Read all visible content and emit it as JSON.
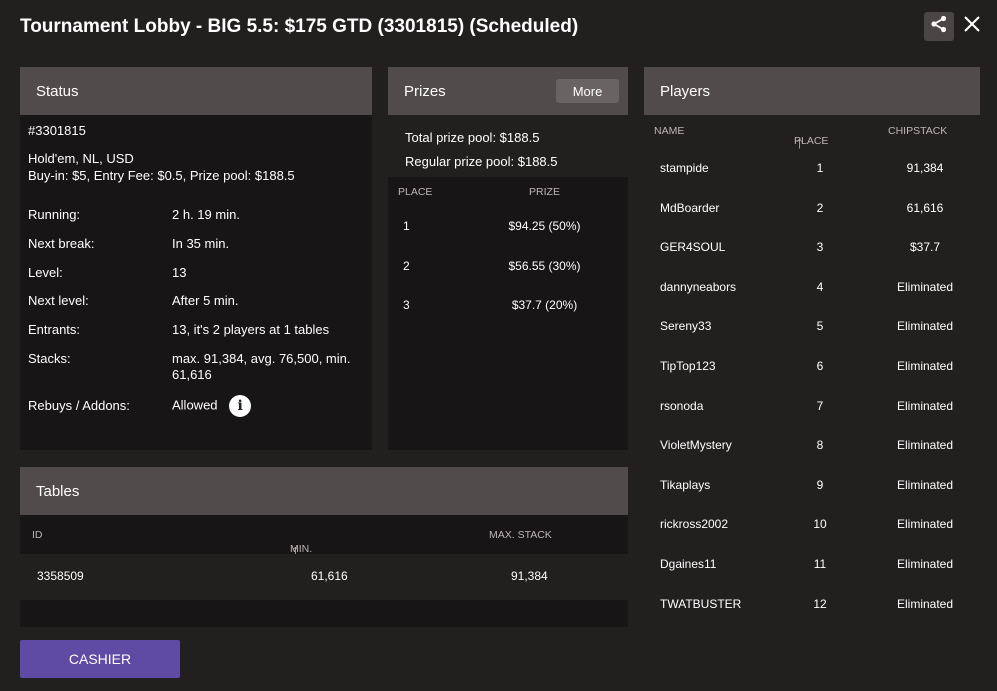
{
  "window": {
    "title": "Tournament Lobby - BIG 5.5: $175 GTD (3301815) (Scheduled)"
  },
  "status": {
    "header": "Status",
    "id": "#3301815",
    "game": "Hold'em, NL, USD",
    "buyin": "Buy-in: $5, Entry Fee: $0.5, Prize pool: $188.5",
    "rows": [
      {
        "label": "Running:",
        "value": "2 h. 19 min."
      },
      {
        "label": "Next break:",
        "value": "In 35 min."
      },
      {
        "label": "Level:",
        "value": "13"
      },
      {
        "label": "Next level:",
        "value": "After 5 min."
      },
      {
        "label": "Entrants:",
        "value": "13, it's 2 players at 1 tables"
      },
      {
        "label": "Stacks:",
        "value": "max. 91,384, avg. 76,500, min. 61,616"
      },
      {
        "label": "Rebuys / Addons:",
        "value": "Allowed"
      }
    ],
    "info_icon": "i"
  },
  "prizes": {
    "header": "Prizes",
    "more_label": "More",
    "total": "Total prize pool: $188.5",
    "regular": "Regular prize pool: $188.5",
    "col_place": "PLACE",
    "col_prize": "PRIZE",
    "rows": [
      {
        "place": "1",
        "prize": "$94.25 (50%)"
      },
      {
        "place": "2",
        "prize": "$56.55 (30%)"
      },
      {
        "place": "3",
        "prize": "$37.7 (20%)"
      }
    ]
  },
  "players": {
    "header": "Players",
    "col_name": "NAME",
    "col_place": "PLACE",
    "col_chips": "CHIPSTACK",
    "rows": [
      {
        "name": "stampide",
        "place": "1",
        "chips": "91,384"
      },
      {
        "name": "MdBoarder",
        "place": "2",
        "chips": "61,616"
      },
      {
        "name": "GER4SOUL",
        "place": "3",
        "chips": "$37.7"
      },
      {
        "name": "dannyneabors",
        "place": "4",
        "chips": "Eliminated"
      },
      {
        "name": "Sereny33",
        "place": "5",
        "chips": "Eliminated"
      },
      {
        "name": "TipTop123",
        "place": "6",
        "chips": "Eliminated"
      },
      {
        "name": "rsonoda",
        "place": "7",
        "chips": "Eliminated"
      },
      {
        "name": "VioletMystery",
        "place": "8",
        "chips": "Eliminated"
      },
      {
        "name": "Tikaplays",
        "place": "9",
        "chips": "Eliminated"
      },
      {
        "name": "rickross2002",
        "place": "10",
        "chips": "Eliminated"
      },
      {
        "name": "Dgaines11",
        "place": "11",
        "chips": "Eliminated"
      },
      {
        "name": "TWATBUSTER",
        "place": "12",
        "chips": "Eliminated"
      }
    ]
  },
  "tables": {
    "header": "Tables",
    "col_id": "ID",
    "col_min": "MIN. STACK",
    "col_max": "MAX. STACK",
    "rows": [
      {
        "id": "3358509",
        "min": "61,616",
        "max": "91,384"
      }
    ]
  },
  "cashier_label": "CASHIER",
  "sort_arrow": "🡑",
  "icons": {
    "share": "share-icon",
    "close": "close-icon",
    "info": "info-icon",
    "sort": "arrow-up-icon"
  },
  "colors": {
    "background": "#221f1f",
    "panel": "#171515",
    "panel_header": "#524b4b",
    "accent": "#5f4ba4"
  }
}
